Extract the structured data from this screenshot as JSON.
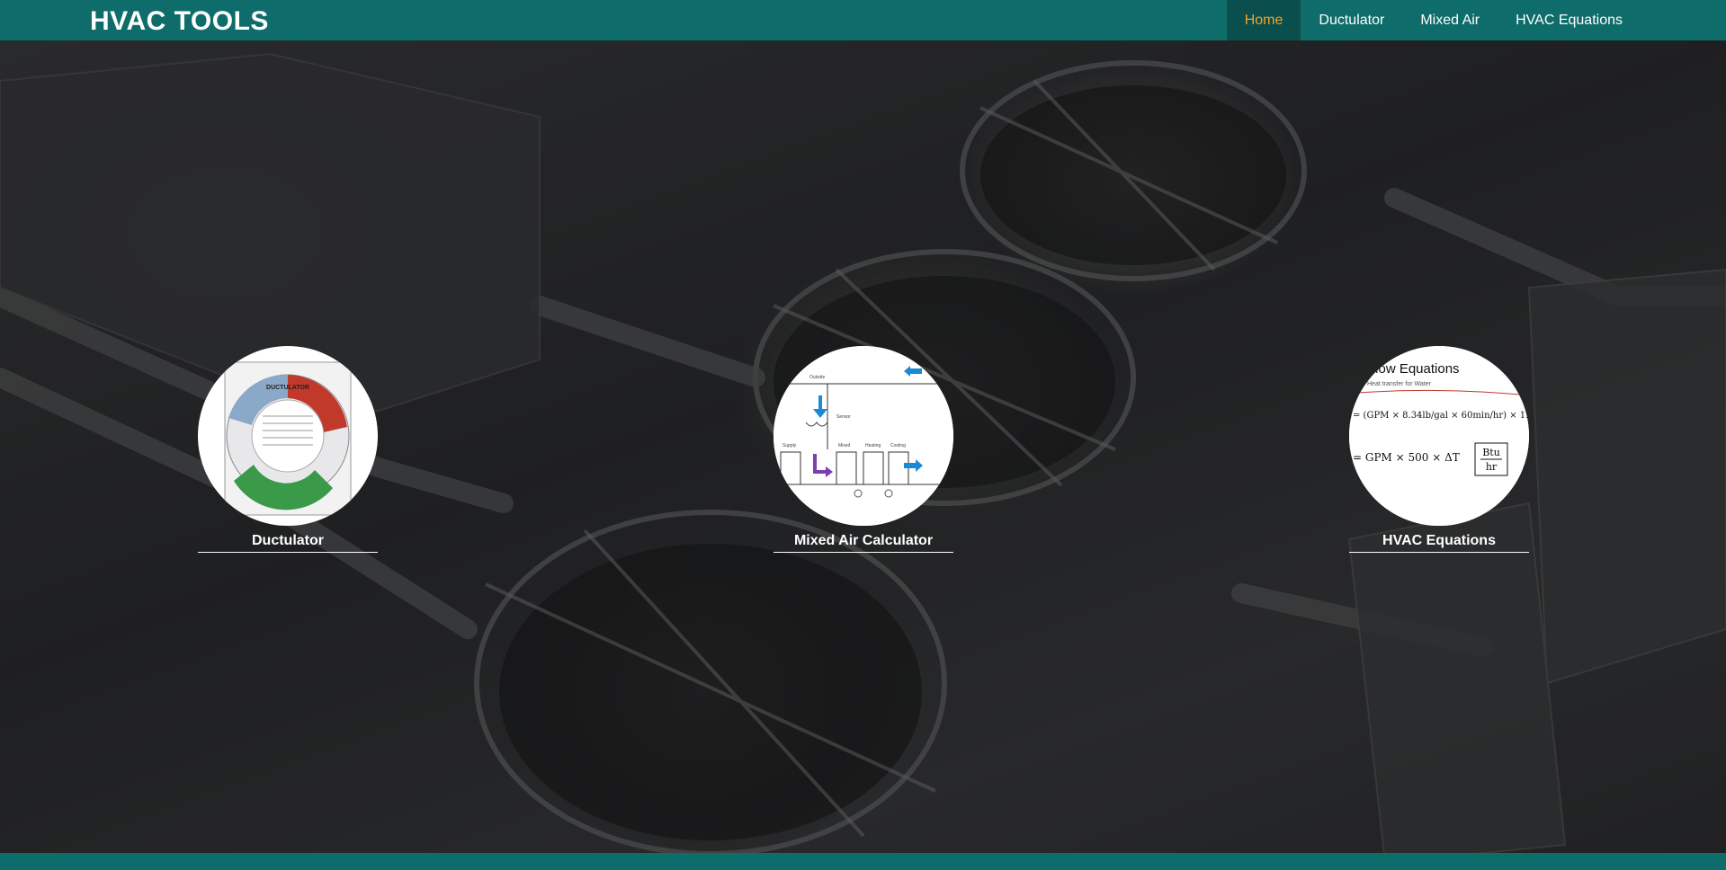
{
  "brand": {
    "title": "HVAC TOOLS"
  },
  "nav": {
    "items": [
      {
        "label": "Home",
        "active": true
      },
      {
        "label": "Ductulator",
        "active": false
      },
      {
        "label": "Mixed Air",
        "active": false
      },
      {
        "label": "HVAC Equations",
        "active": false
      }
    ]
  },
  "tools": [
    {
      "label": "Ductulator",
      "image": "ductulator-wheel-icon"
    },
    {
      "label": "Mixed Air Calculator",
      "image": "mixed-air-diagram-icon"
    },
    {
      "label": "HVAC Equations",
      "image": "flow-equations-icon"
    }
  ],
  "thumbnails": {
    "ductulator_title": "DUCTULATOR",
    "equations_title": "Flow Equations",
    "equations_subtitle": "Heat transfer for Water",
    "equation_1": "= GPM × 500 × ΔT",
    "equation_unit": "Btu",
    "equation_unit_den": "hr"
  },
  "colors": {
    "navbar": "#0e6c6a",
    "nav_active_bg": "#0a4f4d",
    "nav_active_text": "#f0a32a",
    "text": "#ffffff"
  }
}
